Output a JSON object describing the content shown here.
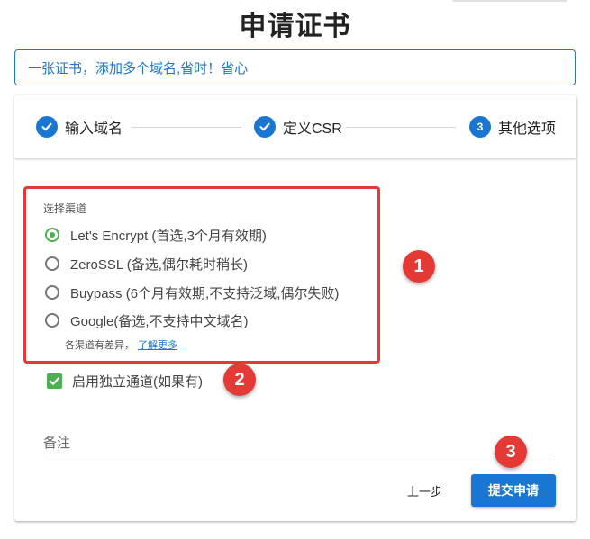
{
  "page": {
    "title": "申请证书",
    "banner": "一张证书，添加多个域名,省时！省心"
  },
  "stepper": {
    "steps": [
      {
        "label": "输入域名",
        "state": "done"
      },
      {
        "label": "定义CSR",
        "state": "done"
      },
      {
        "label": "其他选项",
        "state": "active",
        "number": "3"
      }
    ]
  },
  "form": {
    "channel_caption": "选择渠道",
    "channels": [
      {
        "label": "Let's Encrypt (首选,3个月有效期)",
        "selected": true
      },
      {
        "label": "ZeroSSL (备选,偶尔耗时稍长)",
        "selected": false
      },
      {
        "label": "Buypass (6个月有效期,不支持泛域,偶尔失败)",
        "selected": false
      },
      {
        "label": "Google(备选,不支持中文域名)",
        "selected": false
      }
    ],
    "hint_text": "各渠道有差异，",
    "hint_link": "了解更多",
    "dedicated_channel": {
      "label": "启用独立通道(如果有)",
      "checked": true
    },
    "remark_label": "备注"
  },
  "actions": {
    "back_label": "上一步",
    "submit_label": "提交申请"
  },
  "annotations": [
    "1",
    "2",
    "3"
  ],
  "colors": {
    "primary": "#1976d2",
    "success": "#4caf50",
    "annotation": "#e53935"
  }
}
